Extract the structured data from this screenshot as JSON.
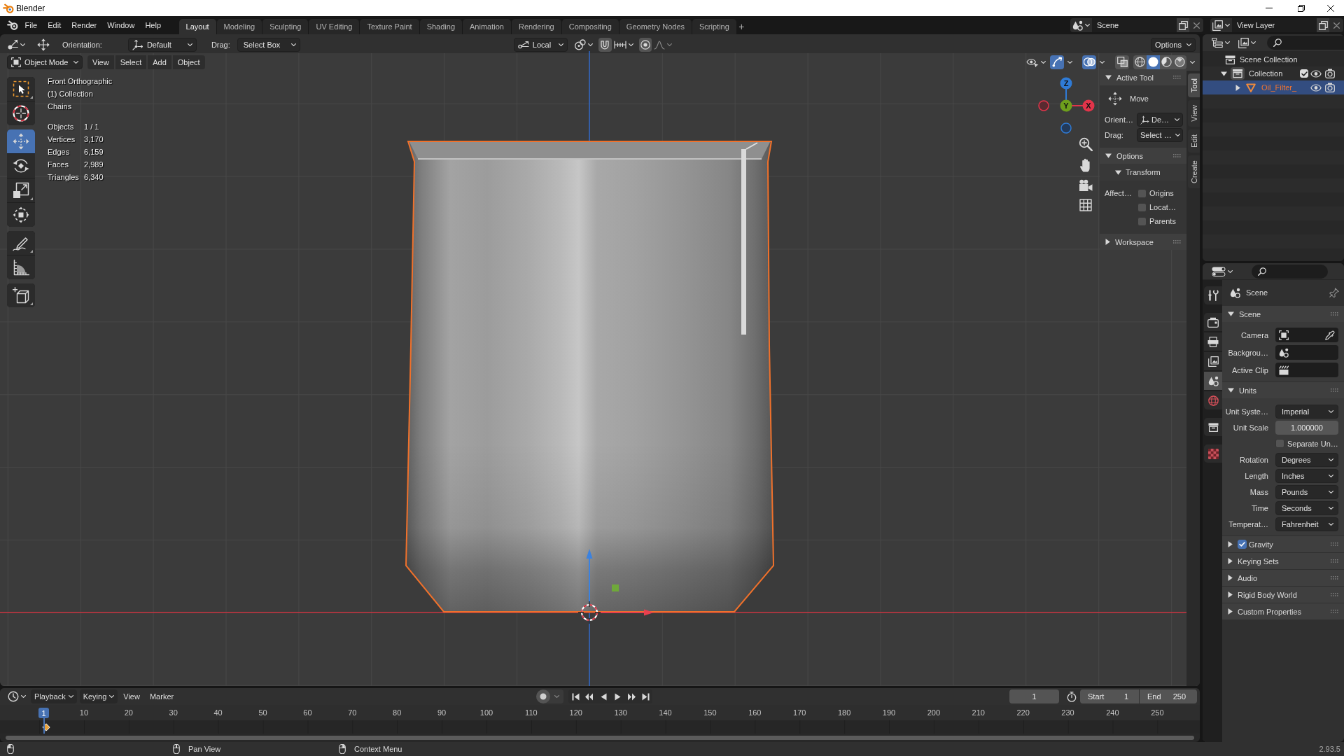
{
  "window": {
    "title": "Blender"
  },
  "topbar": {
    "menu": [
      "File",
      "Edit",
      "Render",
      "Window",
      "Help"
    ],
    "workspaces": [
      {
        "label": "Layout",
        "selected": true
      },
      {
        "label": "Modeling",
        "selected": false
      },
      {
        "label": "Sculpting",
        "selected": false
      },
      {
        "label": "UV Editing",
        "selected": false
      },
      {
        "label": "Texture Paint",
        "selected": false
      },
      {
        "label": "Shading",
        "selected": false
      },
      {
        "label": "Animation",
        "selected": false
      },
      {
        "label": "Rendering",
        "selected": false
      },
      {
        "label": "Compositing",
        "selected": false
      },
      {
        "label": "Geometry Nodes",
        "selected": false
      },
      {
        "label": "Scripting",
        "selected": false
      }
    ],
    "add_workspace": "+",
    "scene": "Scene",
    "view_layer": "View Layer"
  },
  "tool_settings": {
    "orientation_label": "Orientation:",
    "orientation": "Default",
    "drag_label": "Drag:",
    "drag": "Select Box",
    "transform_space": "Local",
    "options": "Options"
  },
  "viewport": {
    "mode": "Object Mode",
    "menus": [
      "View",
      "Select",
      "Add",
      "Object"
    ],
    "gizmos": true,
    "overlays": true,
    "xray": false,
    "shading": [
      {
        "kind": "wireframe",
        "selected": false
      },
      {
        "kind": "solid",
        "selected": true
      },
      {
        "kind": "material",
        "selected": false
      },
      {
        "kind": "rendered",
        "selected": false
      }
    ],
    "toolbar": [
      {
        "tools": [
          {
            "kind": "select_box",
            "selected": false,
            "variants": true
          },
          {
            "kind": "cursor",
            "selected": false,
            "variants": false
          }
        ]
      },
      {
        "tools": [
          {
            "kind": "move",
            "selected": true,
            "variants": false
          },
          {
            "kind": "rotate",
            "selected": false,
            "variants": false
          },
          {
            "kind": "scale",
            "selected": false,
            "variants": true
          },
          {
            "kind": "transform",
            "selected": false,
            "variants": false
          }
        ]
      },
      {
        "tools": [
          {
            "kind": "annotate",
            "selected": false,
            "variants": true
          },
          {
            "kind": "measure",
            "selected": false,
            "variants": false
          }
        ]
      },
      {
        "tools": [
          {
            "kind": "add_cube",
            "selected": false,
            "variants": true
          }
        ]
      }
    ],
    "info": [
      "Front Orthographic",
      "(1) Collection",
      "Chains"
    ],
    "stats": [
      {
        "label": "Objects",
        "value": "1 / 1"
      },
      {
        "label": "Vertices",
        "value": "3,170"
      },
      {
        "label": "Edges",
        "value": "6,159"
      },
      {
        "label": "Faces",
        "value": "2,989"
      },
      {
        "label": "Triangles",
        "value": "6,340"
      }
    ],
    "navigation_axes": [
      {
        "label": "Z",
        "color": "#2f7bd6"
      },
      {
        "label": "Y",
        "color": "#6e9f1c"
      },
      {
        "label": "X",
        "color": "#e3344a"
      }
    ],
    "sidebar": {
      "tabs": [
        {
          "label": "Tool",
          "selected": true
        },
        {
          "label": "View",
          "selected": false
        },
        {
          "label": "Edit",
          "selected": false
        },
        {
          "label": "Create",
          "selected": false
        }
      ],
      "active_tool": {
        "title": "Active Tool",
        "expanded": true,
        "tool": "Move",
        "orientation_label": "Orient…",
        "orientation": "De…",
        "drag_label": "Drag:",
        "drag": "Select …"
      },
      "options": {
        "title": "Options",
        "expanded": true,
        "transform": {
          "title": "Transform",
          "expanded": true,
          "affect_label": "Affect…",
          "affect": [
            {
              "label": "Origins",
              "checked": false
            },
            {
              "label": "Locat…",
              "checked": false
            },
            {
              "label": "Parents",
              "checked": false
            }
          ]
        }
      },
      "workspace": {
        "title": "Workspace",
        "expanded": false
      }
    }
  },
  "outliner": {
    "tree": [
      {
        "label": "Scene Collection",
        "kind": "scene_collection",
        "selected": false,
        "children": [
          {
            "label": "Collection",
            "kind": "collection",
            "selected": false,
            "expanded": true,
            "checked": true,
            "children": [
              {
                "label": "Oil_Filter_",
                "kind": "mesh",
                "selected": true,
                "expanded": false
              }
            ]
          }
        ]
      }
    ]
  },
  "properties": {
    "tab_groups": [
      {
        "tabs": [
          {
            "kind": "tool",
            "selected": false
          }
        ]
      },
      {
        "tabs": [
          {
            "kind": "render",
            "selected": false
          },
          {
            "kind": "output",
            "selected": false
          },
          {
            "kind": "view_layer",
            "selected": false
          },
          {
            "kind": "scene",
            "selected": true
          },
          {
            "kind": "world",
            "selected": false
          }
        ]
      },
      {
        "tabs": [
          {
            "kind": "collection",
            "selected": false
          }
        ]
      },
      {
        "tabs": [
          {
            "kind": "texture",
            "selected": false
          }
        ]
      }
    ],
    "context": "Scene",
    "panels": [
      {
        "title": "Scene",
        "expanded": true,
        "rows": [
          {
            "kind": "object_field",
            "label": "Camera"
          },
          {
            "kind": "scene_field",
            "label": "Backgrou…"
          },
          {
            "kind": "clip_field",
            "label": "Active Clip"
          }
        ]
      },
      {
        "title": "Units",
        "expanded": true,
        "rows": [
          {
            "kind": "dropdown",
            "label": "Unit Syste…",
            "value": "Imperial"
          },
          {
            "kind": "number",
            "label": "Unit Scale",
            "value": "1.000000"
          },
          {
            "kind": "checkbox",
            "label": "Separate Un…",
            "checked": false
          },
          {
            "kind": "dropdown",
            "label": "Rotation",
            "value": "Degrees"
          },
          {
            "kind": "dropdown",
            "label": "Length",
            "value": "Inches"
          },
          {
            "kind": "dropdown",
            "label": "Mass",
            "value": "Pounds"
          },
          {
            "kind": "dropdown",
            "label": "Time",
            "value": "Seconds"
          },
          {
            "kind": "dropdown",
            "label": "Temperat…",
            "value": "Fahrenheit"
          }
        ]
      },
      {
        "title": "Gravity",
        "expanded": false,
        "checked": true
      },
      {
        "title": "Keying Sets",
        "expanded": false
      },
      {
        "title": "Audio",
        "expanded": false
      },
      {
        "title": "Rigid Body World",
        "expanded": false
      },
      {
        "title": "Custom Properties",
        "expanded": false
      }
    ]
  },
  "timeline": {
    "menus": [
      {
        "label": "Playback",
        "kind": "popover"
      },
      {
        "label": "Keying",
        "kind": "popover"
      },
      {
        "label": "View",
        "kind": "menu"
      },
      {
        "label": "Marker",
        "kind": "menu"
      }
    ],
    "auto_keying": false,
    "current_frame": "1",
    "start_label": "Start",
    "start": "1",
    "end_label": "End",
    "end": "250",
    "playhead": "1",
    "ruler": [
      "10",
      "20",
      "30",
      "40",
      "50",
      "60",
      "70",
      "80",
      "90",
      "100",
      "110",
      "120",
      "130",
      "140",
      "150",
      "160",
      "170",
      "180",
      "190",
      "200",
      "210",
      "220",
      "230",
      "240",
      "250"
    ]
  },
  "status_bar": {
    "hints": [
      {
        "kind": "left_mouse"
      },
      {
        "kind": "middle_mouse",
        "label": "Pan View"
      },
      {
        "kind": "right_mouse",
        "label": "Context Menu"
      }
    ],
    "version": "2.93.5"
  }
}
